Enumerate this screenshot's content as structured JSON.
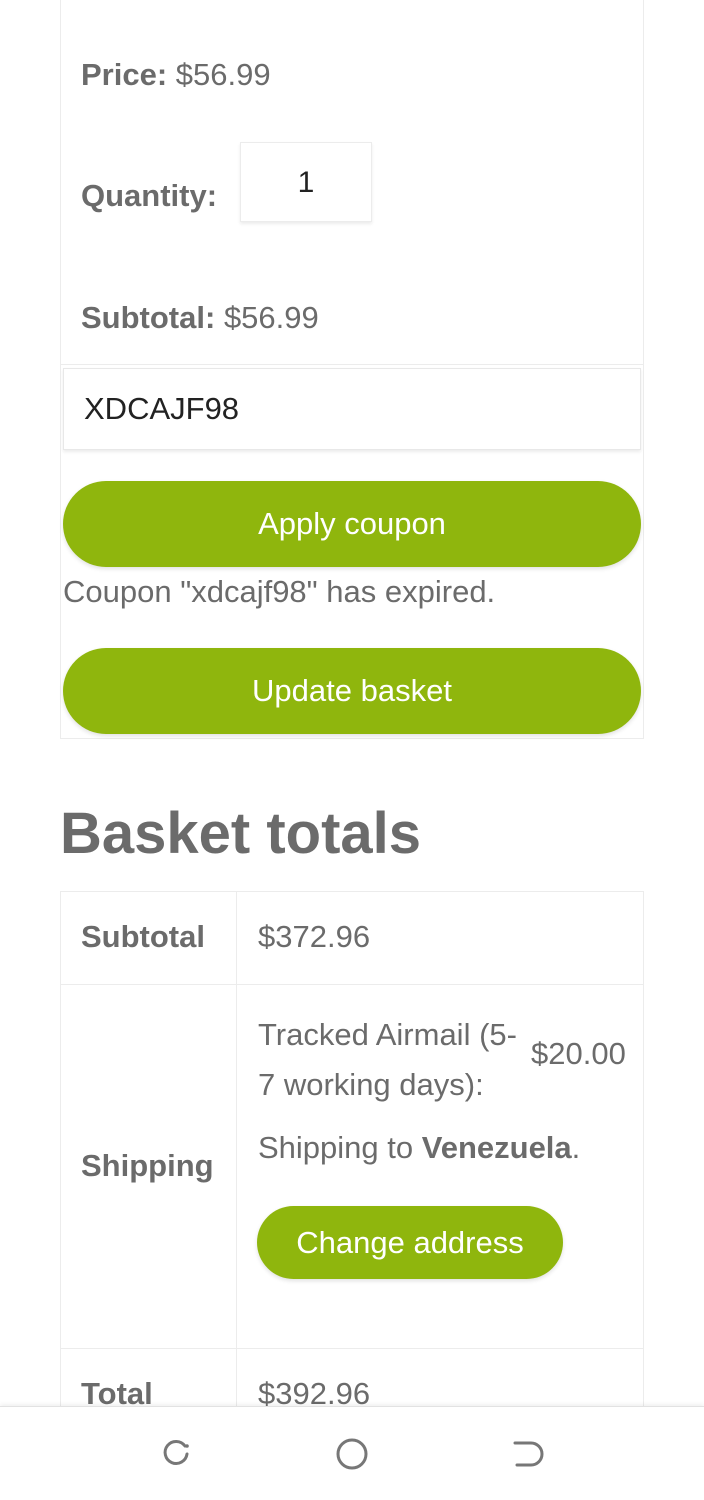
{
  "cart_item": {
    "price_label": "Price:",
    "price_value": "$56.99",
    "quantity_label": "Quantity:",
    "quantity_value": "1",
    "subtotal_label": "Subtotal:",
    "subtotal_value": "$56.99"
  },
  "coupon": {
    "input_value": "XDCAJF98",
    "apply_label": "Apply coupon",
    "notice": "Coupon \"xdcajf98\" has expired.",
    "update_label": "Update basket"
  },
  "totals": {
    "title": "Basket totals",
    "subtotal_label": "Subtotal",
    "subtotal_value": "$372.96",
    "shipping_label": "Shipping",
    "shipping_method": "Tracked Airmail (5-7 working days):",
    "shipping_price": "$20.00",
    "shipping_to_prefix": "Shipping to",
    "shipping_country": "Venezuela",
    "shipping_to_suffix": ".",
    "change_address_label": "Change address",
    "total_label": "Total",
    "total_value": "$392.96"
  },
  "navbar": {
    "icons": [
      "recent-apps-icon",
      "home-icon",
      "back-icon"
    ]
  },
  "colors": {
    "accent": "#8fb60d",
    "text": "#6b6b6b"
  }
}
